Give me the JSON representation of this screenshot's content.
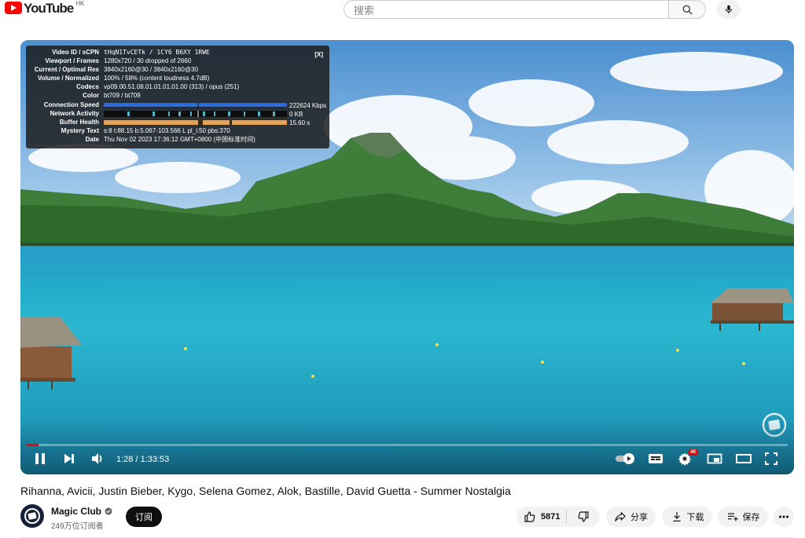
{
  "header": {
    "logo_text": "YouTube",
    "region": "HK",
    "search_placeholder": "搜索",
    "search_icon": "search-icon",
    "mic_icon": "mic-icon"
  },
  "stats_overlay": {
    "close_label": "[X]",
    "rows": [
      {
        "key": "Video ID / sCPN",
        "value": "tHqN1TvCETk / 1CY6 B6XY 1RWE"
      },
      {
        "key": "Viewport / Frames",
        "value": "1280x720 / 30 dropped of 2660"
      },
      {
        "key": "Current / Optimal Res",
        "value": "3840x2160@30 / 3840x2160@30"
      },
      {
        "key": "Volume / Normalized",
        "value": "100% / 58% (content loudness 4.7dB)"
      },
      {
        "key": "Codecs",
        "value": "vp09.00.51.08.01.01.01.01.00 (313) / opus (251)"
      },
      {
        "key": "Color",
        "value": "bt709 / bt709"
      },
      {
        "key": "Connection Speed",
        "value": ""
      },
      {
        "key": "Network Activity",
        "value": ""
      },
      {
        "key": "Buffer Health",
        "value": ""
      },
      {
        "key": "Mystery Text",
        "value": "s:8 t:88.15 b:5.067-103.566 L pl_i:50 pbs:370"
      },
      {
        "key": "Date",
        "value": "Thu Nov 02 2023 17:36:12 GMT+0800 (中国标准时间)"
      }
    ],
    "connection_speed": "222624 Kbps",
    "network_activity": "0 KB",
    "buffer_health": "15.60 s",
    "colors": {
      "connection": "#2d6bd6",
      "network": "#4fb3c9",
      "buffer": "#e3a256"
    }
  },
  "player": {
    "time_text": "1:28 / 1:33:53",
    "progress_fraction": 0.0156,
    "hd_badge": "4K",
    "controls": [
      "pause-icon",
      "next-icon",
      "volume-icon",
      "autoplay-toggle",
      "subtitles-icon",
      "settings-icon",
      "miniplayer-icon",
      "theater-icon",
      "fullscreen-icon"
    ]
  },
  "video": {
    "title": "Rihanna, Avicii, Justin Bieber, Kygo, Selena Gomez, Alok, Bastille, David Guetta - Summer Nostalgia",
    "channel_name": "Magic Club",
    "subscribers": "249万位订阅者",
    "subscribe_label": "订阅",
    "like_count": "5871",
    "share_label": "分享",
    "download_label": "下载",
    "save_label": "保存"
  }
}
